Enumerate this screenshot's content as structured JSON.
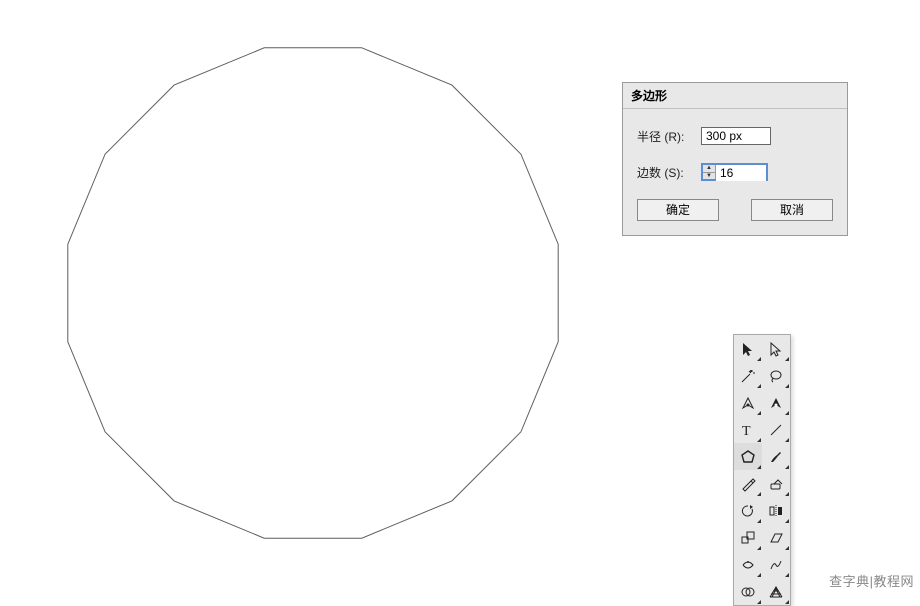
{
  "dialog": {
    "title": "多边形",
    "radius_label": "半径 (R):",
    "radius_value": "300 px",
    "sides_label": "边数 (S):",
    "sides_value": "16",
    "ok_label": "确定",
    "cancel_label": "取消"
  },
  "canvas": {
    "polygon_sides": 16,
    "polygon_radius_px": 250,
    "stroke": "#5e5e5e"
  },
  "tools": {
    "items": [
      {
        "name": "selection-tool",
        "selected": false
      },
      {
        "name": "direct-selection-tool",
        "selected": false
      },
      {
        "name": "magic-wand-tool",
        "selected": false
      },
      {
        "name": "lasso-tool",
        "selected": false
      },
      {
        "name": "pen-tool",
        "selected": false
      },
      {
        "name": "add-anchor-tool",
        "selected": false
      },
      {
        "name": "type-tool",
        "selected": false
      },
      {
        "name": "line-segment-tool",
        "selected": false
      },
      {
        "name": "polygon-tool",
        "selected": true
      },
      {
        "name": "paintbrush-tool",
        "selected": false
      },
      {
        "name": "pencil-tool",
        "selected": false
      },
      {
        "name": "eraser-tool",
        "selected": false
      },
      {
        "name": "rotate-tool",
        "selected": false
      },
      {
        "name": "reflect-tool",
        "selected": false
      },
      {
        "name": "scale-tool",
        "selected": false
      },
      {
        "name": "shear-tool",
        "selected": false
      },
      {
        "name": "width-tool",
        "selected": false
      },
      {
        "name": "warp-tool",
        "selected": false
      },
      {
        "name": "shape-builder-tool",
        "selected": false
      },
      {
        "name": "perspective-grid-tool",
        "selected": false
      }
    ]
  },
  "watermark": "查字典|教程网"
}
